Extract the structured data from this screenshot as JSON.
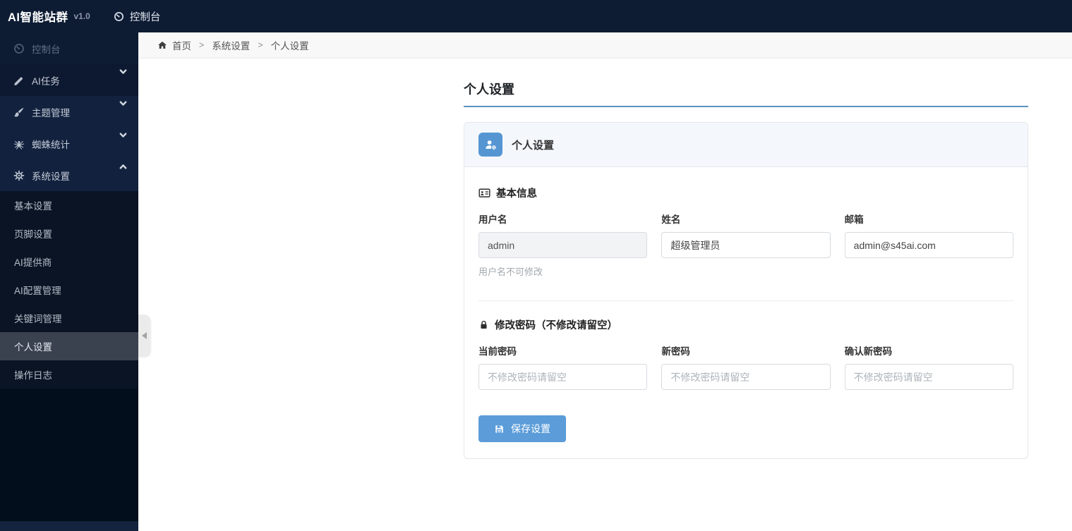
{
  "app": {
    "brand": "AI智能站群",
    "version": "v1.0",
    "nav_console": "控制台"
  },
  "colors": {
    "navbar_bg": "#0d1b33",
    "accent_blue": "#5b9cd9",
    "title_underline": "#5b93bd",
    "active_item_bg": "#3a4250",
    "card_header_icon_bg": "#5596d2"
  },
  "sidebar": {
    "items": [
      {
        "label": "控制台",
        "icon": "tachometer-icon",
        "state": "dimmed"
      },
      {
        "label": "AI任务",
        "icon": "pencil-icon",
        "expandable": true
      },
      {
        "label": "主题管理",
        "icon": "brush-icon",
        "expandable": true
      },
      {
        "label": "蜘蛛统计",
        "icon": "spider-icon",
        "expandable": true
      },
      {
        "label": "系统设置",
        "icon": "gear-icon",
        "expandable": true,
        "expanded": true
      }
    ],
    "submenu": [
      {
        "label": "基本设置"
      },
      {
        "label": "页脚设置"
      },
      {
        "label": "AI提供商"
      },
      {
        "label": "AI配置管理"
      },
      {
        "label": "关键词管理"
      },
      {
        "label": "个人设置",
        "active": true
      },
      {
        "label": "操作日志"
      }
    ]
  },
  "breadcrumb": {
    "home": "首页",
    "separator": ">",
    "section": "系统设置",
    "current": "个人设置"
  },
  "page": {
    "title": "个人设置"
  },
  "card": {
    "header_title": "个人设置",
    "basic_info": {
      "heading": "基本信息",
      "fields": [
        {
          "label": "用户名",
          "value": "admin",
          "disabled": true,
          "hint": "用户名不可修改"
        },
        {
          "label": "姓名",
          "value": "超级管理员"
        },
        {
          "label": "邮箱",
          "value": "admin@s45ai.com"
        }
      ]
    },
    "password": {
      "heading": "修改密码（不修改请留空）",
      "fields": [
        {
          "label": "当前密码",
          "placeholder": "不修改密码请留空"
        },
        {
          "label": "新密码",
          "placeholder": "不修改密码请留空"
        },
        {
          "label": "确认新密码",
          "placeholder": "不修改密码请留空"
        }
      ]
    },
    "save_button": "保存设置"
  }
}
